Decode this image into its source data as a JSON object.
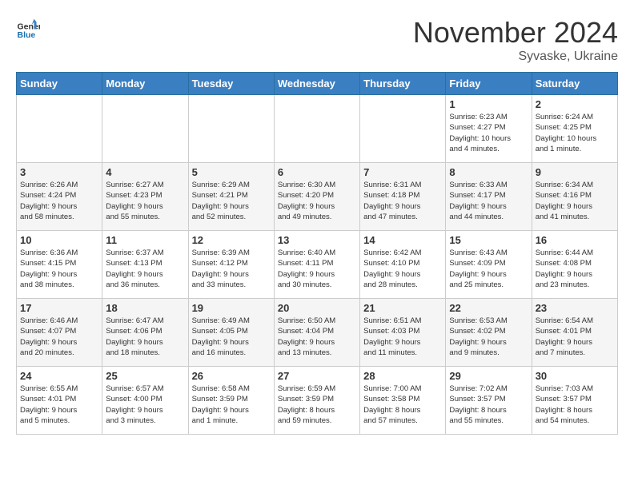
{
  "header": {
    "logo_general": "General",
    "logo_blue": "Blue",
    "month_title": "November 2024",
    "subtitle": "Syvaske, Ukraine"
  },
  "weekdays": [
    "Sunday",
    "Monday",
    "Tuesday",
    "Wednesday",
    "Thursday",
    "Friday",
    "Saturday"
  ],
  "weeks": [
    [
      {
        "day": "",
        "info": ""
      },
      {
        "day": "",
        "info": ""
      },
      {
        "day": "",
        "info": ""
      },
      {
        "day": "",
        "info": ""
      },
      {
        "day": "",
        "info": ""
      },
      {
        "day": "1",
        "info": "Sunrise: 6:23 AM\nSunset: 4:27 PM\nDaylight: 10 hours\nand 4 minutes."
      },
      {
        "day": "2",
        "info": "Sunrise: 6:24 AM\nSunset: 4:25 PM\nDaylight: 10 hours\nand 1 minute."
      }
    ],
    [
      {
        "day": "3",
        "info": "Sunrise: 6:26 AM\nSunset: 4:24 PM\nDaylight: 9 hours\nand 58 minutes."
      },
      {
        "day": "4",
        "info": "Sunrise: 6:27 AM\nSunset: 4:23 PM\nDaylight: 9 hours\nand 55 minutes."
      },
      {
        "day": "5",
        "info": "Sunrise: 6:29 AM\nSunset: 4:21 PM\nDaylight: 9 hours\nand 52 minutes."
      },
      {
        "day": "6",
        "info": "Sunrise: 6:30 AM\nSunset: 4:20 PM\nDaylight: 9 hours\nand 49 minutes."
      },
      {
        "day": "7",
        "info": "Sunrise: 6:31 AM\nSunset: 4:18 PM\nDaylight: 9 hours\nand 47 minutes."
      },
      {
        "day": "8",
        "info": "Sunrise: 6:33 AM\nSunset: 4:17 PM\nDaylight: 9 hours\nand 44 minutes."
      },
      {
        "day": "9",
        "info": "Sunrise: 6:34 AM\nSunset: 4:16 PM\nDaylight: 9 hours\nand 41 minutes."
      }
    ],
    [
      {
        "day": "10",
        "info": "Sunrise: 6:36 AM\nSunset: 4:15 PM\nDaylight: 9 hours\nand 38 minutes."
      },
      {
        "day": "11",
        "info": "Sunrise: 6:37 AM\nSunset: 4:13 PM\nDaylight: 9 hours\nand 36 minutes."
      },
      {
        "day": "12",
        "info": "Sunrise: 6:39 AM\nSunset: 4:12 PM\nDaylight: 9 hours\nand 33 minutes."
      },
      {
        "day": "13",
        "info": "Sunrise: 6:40 AM\nSunset: 4:11 PM\nDaylight: 9 hours\nand 30 minutes."
      },
      {
        "day": "14",
        "info": "Sunrise: 6:42 AM\nSunset: 4:10 PM\nDaylight: 9 hours\nand 28 minutes."
      },
      {
        "day": "15",
        "info": "Sunrise: 6:43 AM\nSunset: 4:09 PM\nDaylight: 9 hours\nand 25 minutes."
      },
      {
        "day": "16",
        "info": "Sunrise: 6:44 AM\nSunset: 4:08 PM\nDaylight: 9 hours\nand 23 minutes."
      }
    ],
    [
      {
        "day": "17",
        "info": "Sunrise: 6:46 AM\nSunset: 4:07 PM\nDaylight: 9 hours\nand 20 minutes."
      },
      {
        "day": "18",
        "info": "Sunrise: 6:47 AM\nSunset: 4:06 PM\nDaylight: 9 hours\nand 18 minutes."
      },
      {
        "day": "19",
        "info": "Sunrise: 6:49 AM\nSunset: 4:05 PM\nDaylight: 9 hours\nand 16 minutes."
      },
      {
        "day": "20",
        "info": "Sunrise: 6:50 AM\nSunset: 4:04 PM\nDaylight: 9 hours\nand 13 minutes."
      },
      {
        "day": "21",
        "info": "Sunrise: 6:51 AM\nSunset: 4:03 PM\nDaylight: 9 hours\nand 11 minutes."
      },
      {
        "day": "22",
        "info": "Sunrise: 6:53 AM\nSunset: 4:02 PM\nDaylight: 9 hours\nand 9 minutes."
      },
      {
        "day": "23",
        "info": "Sunrise: 6:54 AM\nSunset: 4:01 PM\nDaylight: 9 hours\nand 7 minutes."
      }
    ],
    [
      {
        "day": "24",
        "info": "Sunrise: 6:55 AM\nSunset: 4:01 PM\nDaylight: 9 hours\nand 5 minutes."
      },
      {
        "day": "25",
        "info": "Sunrise: 6:57 AM\nSunset: 4:00 PM\nDaylight: 9 hours\nand 3 minutes."
      },
      {
        "day": "26",
        "info": "Sunrise: 6:58 AM\nSunset: 3:59 PM\nDaylight: 9 hours\nand 1 minute."
      },
      {
        "day": "27",
        "info": "Sunrise: 6:59 AM\nSunset: 3:59 PM\nDaylight: 8 hours\nand 59 minutes."
      },
      {
        "day": "28",
        "info": "Sunrise: 7:00 AM\nSunset: 3:58 PM\nDaylight: 8 hours\nand 57 minutes."
      },
      {
        "day": "29",
        "info": "Sunrise: 7:02 AM\nSunset: 3:57 PM\nDaylight: 8 hours\nand 55 minutes."
      },
      {
        "day": "30",
        "info": "Sunrise: 7:03 AM\nSunset: 3:57 PM\nDaylight: 8 hours\nand 54 minutes."
      }
    ]
  ]
}
